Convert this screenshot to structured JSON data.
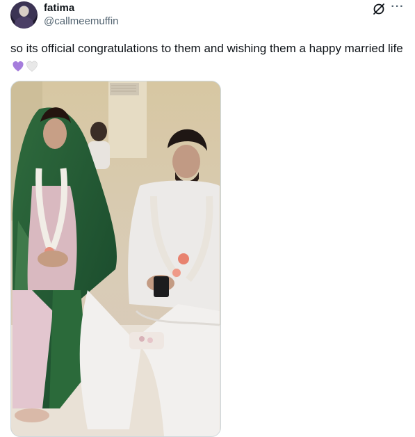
{
  "author": {
    "display_name": "fatima",
    "handle": "@callmeemuffin",
    "avatar_icon": "profile-avatar"
  },
  "header_actions": {
    "grok_icon": "grok-icon",
    "more_icon": "more-options-icon",
    "more_glyph": "···"
  },
  "tweet": {
    "text": "so its official congratulations to them and wishing them a happy married life",
    "emojis": [
      "purple-heart",
      "white-heart"
    ]
  },
  "colors": {
    "text_primary": "#0f1419",
    "text_secondary": "#536471",
    "border": "#cfd9de",
    "purple_heart": "#a57ddc"
  },
  "media": {
    "type": "video-thumbnail",
    "description_icon": "wedding-photo"
  }
}
